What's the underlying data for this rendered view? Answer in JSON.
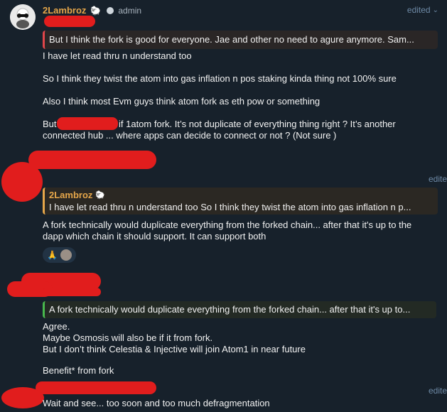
{
  "msg1": {
    "sender": "2Lambroz",
    "role": "admin",
    "edited": "edited",
    "reply_text": "But I think the fork is good for everyone.  Jae and other no need to agure anymore.  Sam...",
    "lines": [
      "I have let read thru n understand too",
      "So I think they twist the atom into gas  inflation n pos staking kinda thing not 100% sure",
      "Also I think most Evm guys think atom fork as eth pow or something",
      "But",
      "if 1atom fork. It’s not duplicate of everything thing right ? It’s another",
      "connected hub ... where apps can decide to connect or not ? (Not sure )"
    ]
  },
  "msg2": {
    "edited": "edite",
    "reply_sender": "2Lambroz",
    "reply_text": "I have let read thru n understand too  So I think they twist the atom into gas  inflation n p...",
    "lines": [
      "A fork technically would duplicate everything from the forked chain... after that it's up to the",
      "dapp which chain it should support.  It can support both"
    ],
    "reaction_emoji": "🙏"
  },
  "msg3": {
    "reply_text": "A fork technically would duplicate everything from the forked chain... after that it's up to...",
    "lines": [
      "Agree.",
      "Maybe Osmosis will also be if it from fork.",
      "But I don’t think Celestia & Injective will join Atom1 in near future",
      "Benefit* from fork"
    ]
  },
  "msg4": {
    "edited": "edite",
    "lines": [
      "Wait and see... too soon and too much defragmentation"
    ]
  },
  "colors": {
    "background": "#17212b",
    "sender": "#e5a64a",
    "redaction": "#e11d1d"
  }
}
